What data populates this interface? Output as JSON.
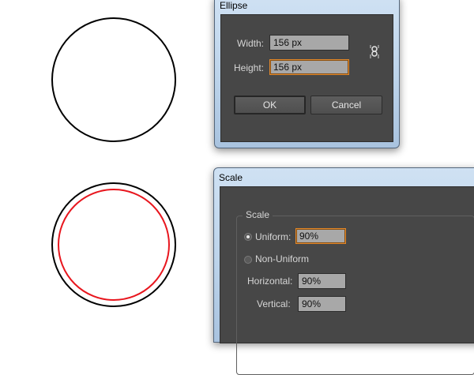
{
  "ellipse_dialog": {
    "title": "Ellipse",
    "width_label": "Width:",
    "width_value": "156 px",
    "height_label": "Height:",
    "height_value": "156 px",
    "ok_label": "OK",
    "cancel_label": "Cancel"
  },
  "scale_dialog": {
    "title": "Scale",
    "group_title": "Scale",
    "uniform_label": "Uniform:",
    "uniform_value": "90%",
    "non_uniform_label": "Non-Uniform",
    "horizontal_label": "Horizontal:",
    "horizontal_value": "90%",
    "vertical_label": "Vertical:",
    "vertical_value": "90%",
    "selected_option": "Uniform"
  },
  "colors": {
    "circle_outline": "#000000",
    "inner_circle": "#e8161e",
    "dialog_background": "#474747",
    "focus_border": "#e3892b"
  }
}
